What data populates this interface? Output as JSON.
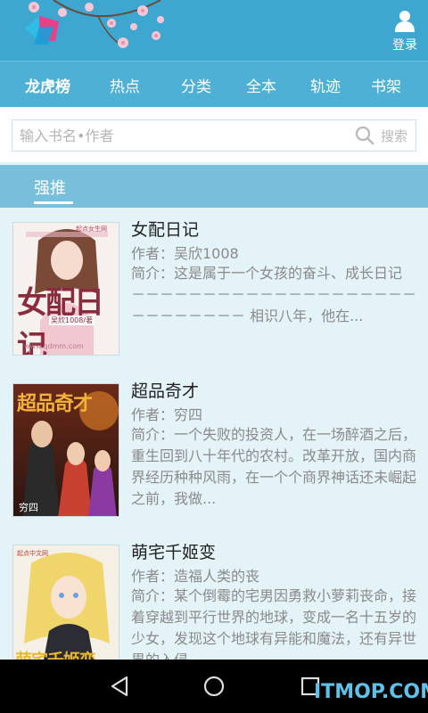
{
  "header": {
    "login_label": "登录"
  },
  "tabs": [
    {
      "label": "龙虎榜",
      "active": true
    },
    {
      "label": "热点",
      "active": false
    },
    {
      "label": "分类",
      "active": false
    },
    {
      "label": "全本",
      "active": false
    },
    {
      "label": "轨迹",
      "active": false
    },
    {
      "label": "书架",
      "active": false
    }
  ],
  "search": {
    "placeholder": "输入书名•作者",
    "button_label": "搜索"
  },
  "section": {
    "title": "强推"
  },
  "books": [
    {
      "title": "女配日记",
      "author": "作者：吴欣1008",
      "description": "简介：这是属于一个女孩的奋斗、成长日记 －－－－－－－－－－－－－－－－－－－－－－－－－－－－ 相识八年，他在...",
      "cover": {
        "big_text": "女配日记",
        "author_tag": "吴欣1008/著",
        "site": "www.qdmm.com",
        "brand": "起点女生网"
      }
    },
    {
      "title": "超品奇才",
      "author": "作者：穷四",
      "description": "简介：一个失败的投资人，在一场醉酒之后，重生回到八十年代的农村。改革开放，国内商界经历种种风雨，在一个个商界神话还未崛起之前，我做...",
      "cover": {
        "big_text": "超品奇才",
        "author_tag": "穷四"
      }
    },
    {
      "title": "萌宅千姬变",
      "author": "作者：造福人类的丧",
      "description": "简介：某个倒霉的宅男因勇救小萝莉丧命，接着穿越到平行世界的地球，变成一名十五岁的少女，发现这个地球有异能和魔法，还有异世界的入侵...",
      "cover": {
        "big_text": "萌宅千姬变",
        "brand": "起点中文网"
      }
    }
  ],
  "watermark": "ITMOP.COM",
  "colors": {
    "header": "#3da7cf",
    "tabs": "#4fb0d6",
    "section": "#78bfdc",
    "list_bg": "#e4f3f7"
  }
}
